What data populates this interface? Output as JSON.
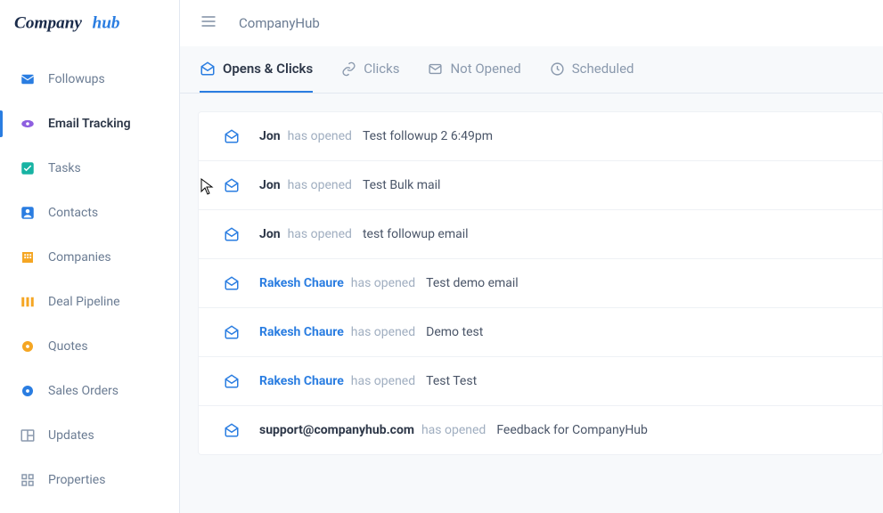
{
  "brand": {
    "name": "Companyhub"
  },
  "topbar": {
    "title": "CompanyHub"
  },
  "sidebar": {
    "items": [
      {
        "label": "Followups",
        "icon": "mail",
        "active": false
      },
      {
        "label": "Email Tracking",
        "icon": "eye",
        "active": true
      },
      {
        "label": "Tasks",
        "icon": "check",
        "active": false
      },
      {
        "label": "Contacts",
        "icon": "person",
        "active": false
      },
      {
        "label": "Companies",
        "icon": "building",
        "active": false
      },
      {
        "label": "Deal Pipeline",
        "icon": "columns",
        "active": false
      },
      {
        "label": "Quotes",
        "icon": "gear",
        "active": false
      },
      {
        "label": "Sales Orders",
        "icon": "gear",
        "active": false
      },
      {
        "label": "Updates",
        "icon": "layout",
        "active": false
      },
      {
        "label": "Properties",
        "icon": "grid",
        "active": false
      }
    ]
  },
  "tabs": [
    {
      "label": "Opens & Clicks",
      "icon": "mail-open",
      "active": true
    },
    {
      "label": "Clicks",
      "icon": "link",
      "active": false
    },
    {
      "label": "Not Opened",
      "icon": "mail",
      "active": false
    },
    {
      "label": "Scheduled",
      "icon": "clock",
      "active": false
    }
  ],
  "events": [
    {
      "who": "Jon",
      "link": false,
      "action": "has opened",
      "subject": "Test followup 2 6:49pm"
    },
    {
      "who": "Jon",
      "link": false,
      "action": "has opened",
      "subject": "Test Bulk mail"
    },
    {
      "who": "Jon",
      "link": false,
      "action": "has opened",
      "subject": "test followup email"
    },
    {
      "who": "Rakesh Chaure",
      "link": true,
      "action": "has opened",
      "subject": "Test demo email"
    },
    {
      "who": "Rakesh Chaure",
      "link": true,
      "action": "has opened",
      "subject": "Demo test"
    },
    {
      "who": "Rakesh Chaure",
      "link": true,
      "action": "has opened",
      "subject": "Test Test"
    },
    {
      "who": "support@companyhub.com",
      "link": false,
      "action": "has opened",
      "subject": "Feedback for CompanyHub"
    }
  ],
  "colors": {
    "accent": "#2a7de1",
    "orange": "#f5a623",
    "purple": "#8e5fe0",
    "teal": "#17b3a3"
  }
}
